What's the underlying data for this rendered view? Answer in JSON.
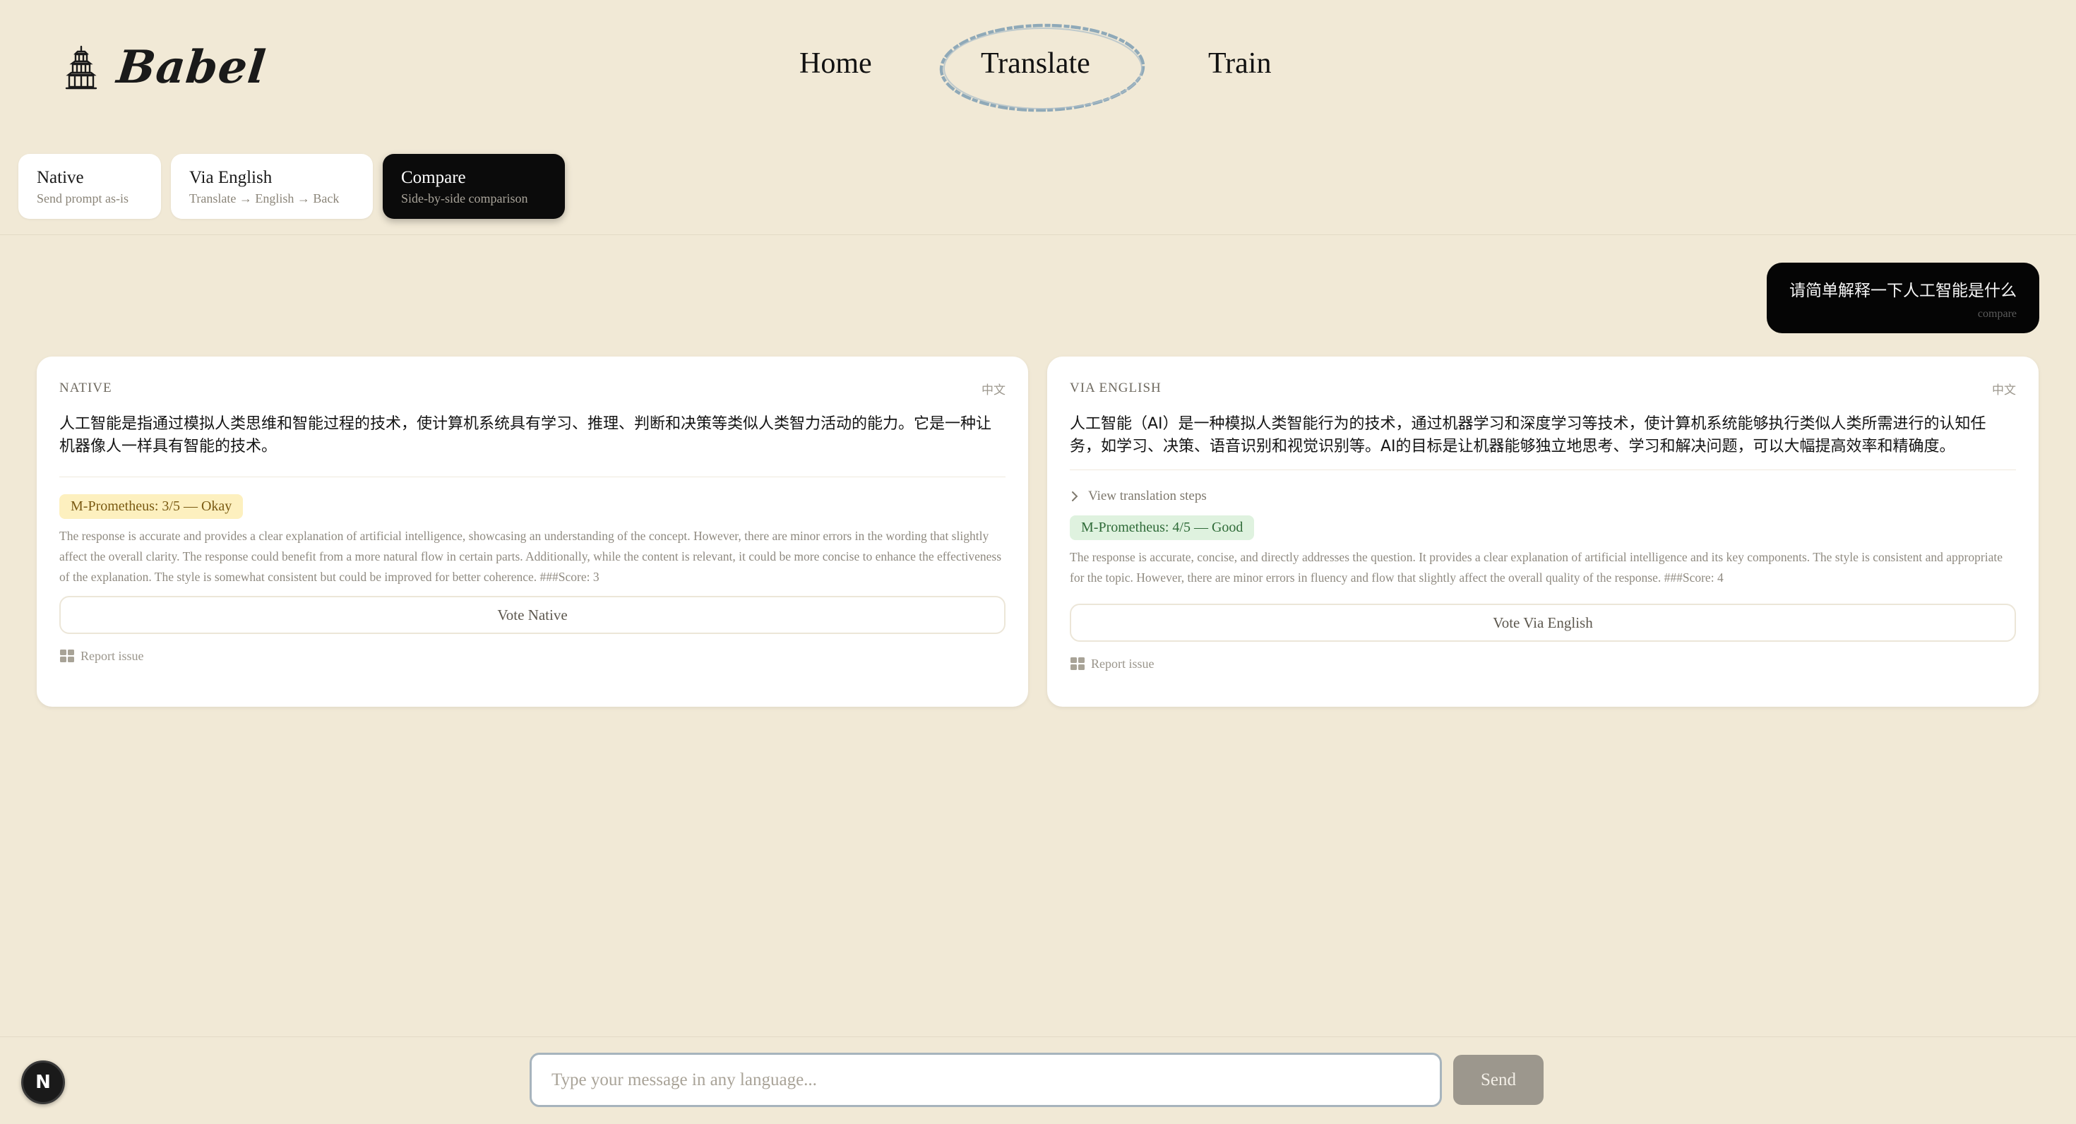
{
  "brand": {
    "name": "Babel",
    "icon": "pagoda-icon"
  },
  "nav": {
    "items": [
      {
        "label": "Home"
      },
      {
        "label": "Translate",
        "active": true
      },
      {
        "label": "Train"
      }
    ]
  },
  "modes": [
    {
      "title": "Native",
      "subtitle": "Send prompt as-is"
    },
    {
      "title": "Via English",
      "subtitle": "Translate → English → Back"
    },
    {
      "title": "Compare",
      "subtitle": "Side-by-side comparison",
      "active": true
    }
  ],
  "user_message": {
    "text": "请简单解释一下人工智能是什么",
    "mode_tag": "compare"
  },
  "cards": {
    "native": {
      "label": "NATIVE",
      "lang": "中文",
      "answer": "人工智能是指通过模拟人类思维和智能过程的技术，使计算机系统具有学习、推理、判断和决策等类似人类智力活动的能力。它是一种让机器像人一样具有智能的技术。",
      "score_label": "M-Prometheus: 3/5 — Okay",
      "score_value": 3,
      "feedback": "The response is accurate and provides a clear explanation of artificial intelligence, showcasing an understanding of the concept. However, there are minor errors in the wording that slightly affect the overall clarity. The response could benefit from a more natural flow in certain parts. Additionally, while the content is relevant, it could be more concise to enhance the effectiveness of the explanation. The style is somewhat consistent but could be improved for better coherence. ###Score: 3",
      "vote_label": "Vote Native",
      "report_label": "Report issue"
    },
    "via": {
      "label": "VIA ENGLISH",
      "lang": "中文",
      "answer": "人工智能（AI）是一种模拟人类智能行为的技术，通过机器学习和深度学习等技术，使计算机系统能够执行类似人类所需进行的认知任务，如学习、决策、语音识别和视觉识别等。AI的目标是让机器能够独立地思考、学习和解决问题，可以大幅提高效率和精确度。",
      "steps_label": "View translation steps",
      "score_label": "M-Prometheus: 4/5 — Good",
      "score_value": 4,
      "feedback": "The response is accurate, concise, and directly addresses the question. It provides a clear explanation of artificial intelligence and its key components. The style is consistent and appropriate for the topic. However, there are minor errors in fluency and flow that slightly affect the overall quality of the response. ###Score: 4",
      "vote_label": "Vote Via English",
      "report_label": "Report issue"
    }
  },
  "composer": {
    "placeholder": "Type your message in any language...",
    "send_label": "Send"
  },
  "avatar": {
    "initial": "N"
  },
  "colors": {
    "background": "#f1e9d6",
    "active_mode": "#0b0b0b",
    "okay_badge": "#fdf0bf",
    "good_badge": "#dff2df",
    "nav_circle": "#8fa9b8",
    "send_button": "#9c978d"
  }
}
